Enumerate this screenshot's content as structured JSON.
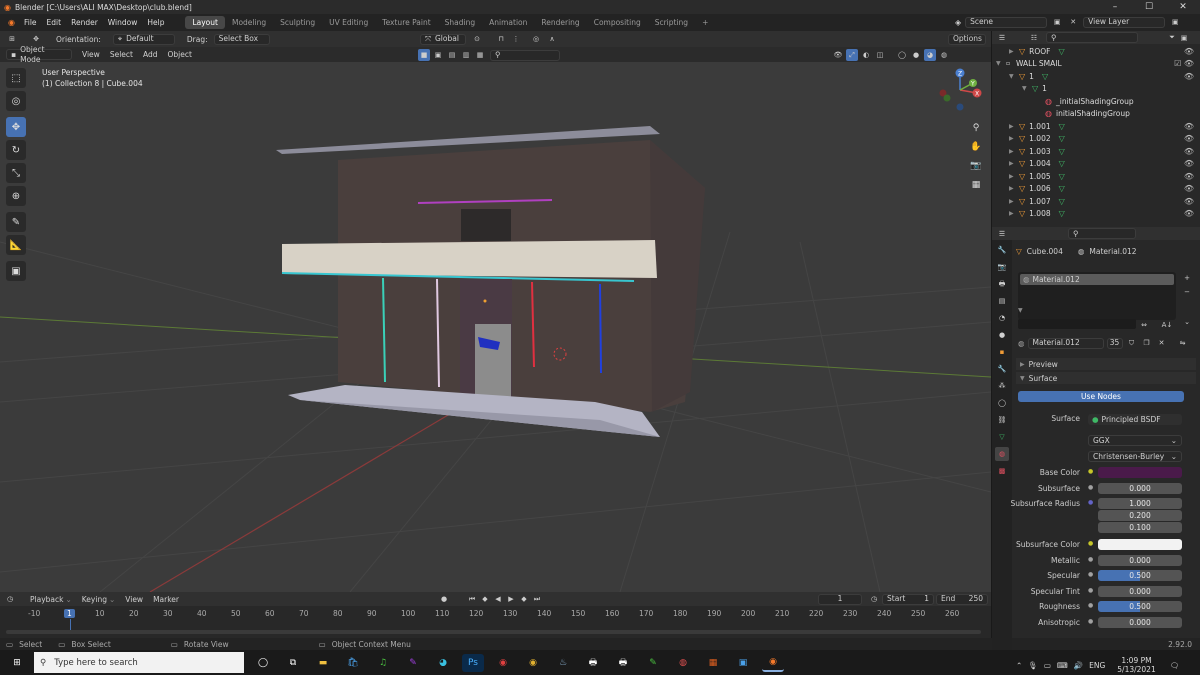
{
  "titlebar": {
    "title": "Blender [C:\\Users\\ALI MAX\\Desktop\\club.blend]",
    "min": "–",
    "max": "☐",
    "close": "✕"
  },
  "menu": [
    "File",
    "Edit",
    "Render",
    "Window",
    "Help"
  ],
  "workspaces": [
    "Layout",
    "Modeling",
    "Sculpting",
    "UV Editing",
    "Texture Paint",
    "Shading",
    "Animation",
    "Rendering",
    "Compositing",
    "Scripting"
  ],
  "add_workspace": "+",
  "scene": {
    "label": "Scene",
    "view_layer": "View Layer"
  },
  "header": {
    "orientation_label": "Orientation:",
    "orientation_value": "Default",
    "drag_label": "Drag:",
    "drag_value": "Select Box",
    "transform": "Global",
    "options": "Options"
  },
  "header2": {
    "mode": "Object Mode",
    "items": [
      "View",
      "Select",
      "Add",
      "Object"
    ]
  },
  "viewport": {
    "view_name": "User Perspective",
    "collection_info": "(1) Collection 8 | Cube.004"
  },
  "gizmo": {
    "x": "X",
    "y": "Y",
    "z": "Z"
  },
  "timeline": {
    "menu": [
      "Playback",
      "Keying",
      "View",
      "Marker"
    ],
    "current_frame": "1",
    "start_label": "Start",
    "start": "1",
    "end_label": "End",
    "end": "250",
    "ticks": [
      "-10",
      "1",
      "10",
      "20",
      "30",
      "40",
      "50",
      "60",
      "70",
      "80",
      "90",
      "100",
      "110",
      "120",
      "130",
      "140",
      "150",
      "160",
      "170",
      "180",
      "190",
      "200",
      "210",
      "220",
      "230",
      "240",
      "250",
      "260"
    ]
  },
  "statusbar": {
    "select": "Select",
    "box_select": "Box Select",
    "rotate": "Rotate View",
    "context": "Object Context Menu",
    "version": "2.92.0"
  },
  "outliner": {
    "rows": [
      {
        "name": "ROOF",
        "indent": 1,
        "type": "obj"
      },
      {
        "name": "WALL SMAIL",
        "indent": 0,
        "type": "col"
      },
      {
        "name": "1",
        "indent": 1,
        "type": "obj"
      },
      {
        "name": "1",
        "indent": 2,
        "type": "mesh"
      },
      {
        "name": "_initialShadingGroup",
        "indent": 3,
        "type": "mat"
      },
      {
        "name": "initialShadingGroup",
        "indent": 3,
        "type": "mat"
      },
      {
        "name": "1.001",
        "indent": 1,
        "type": "obj"
      },
      {
        "name": "1.002",
        "indent": 1,
        "type": "obj"
      },
      {
        "name": "1.003",
        "indent": 1,
        "type": "obj"
      },
      {
        "name": "1.004",
        "indent": 1,
        "type": "obj"
      },
      {
        "name": "1.005",
        "indent": 1,
        "type": "obj"
      },
      {
        "name": "1.006",
        "indent": 1,
        "type": "obj"
      },
      {
        "name": "1.007",
        "indent": 1,
        "type": "obj"
      },
      {
        "name": "1.008",
        "indent": 1,
        "type": "obj"
      }
    ]
  },
  "properties": {
    "object": "Cube.004",
    "material": "Material.012",
    "slot": "Material.012",
    "datablock": "Material.012",
    "users": "35",
    "preview": "Preview",
    "surface_panel": "Surface",
    "use_nodes": "Use Nodes",
    "surface_label": "Surface",
    "surface_value": "Principled BSDF",
    "distribution": "GGX",
    "subsurface_method": "Christensen-Burley",
    "fields": [
      {
        "label": "Base Color",
        "kind": "color",
        "color": "#4a1a4a"
      },
      {
        "label": "Subsurface",
        "value": "0.000"
      },
      {
        "label": "Subsurface Radius",
        "value": "1.000"
      },
      {
        "label": "",
        "value": "0.200"
      },
      {
        "label": "",
        "value": "0.100"
      },
      {
        "label": "Subsurface Color",
        "kind": "color",
        "color": "#f2f2f2"
      },
      {
        "label": "Metallic",
        "value": "0.000"
      },
      {
        "label": "Specular",
        "value": "0.500",
        "fill": 0.5
      },
      {
        "label": "Specular Tint",
        "value": "0.000"
      },
      {
        "label": "Roughness",
        "value": "0.500",
        "fill": 0.5
      },
      {
        "label": "Anisotropic",
        "value": "0.000"
      }
    ]
  },
  "taskbar": {
    "search_placeholder": "Type here to search",
    "lang": "ENG",
    "time": "1:09 PM",
    "date": "5/13/2021"
  },
  "colors": {
    "accent": "#4772b3",
    "active_tool": "#4772b3",
    "orange": "#f09c37",
    "green": "#3fb866"
  }
}
